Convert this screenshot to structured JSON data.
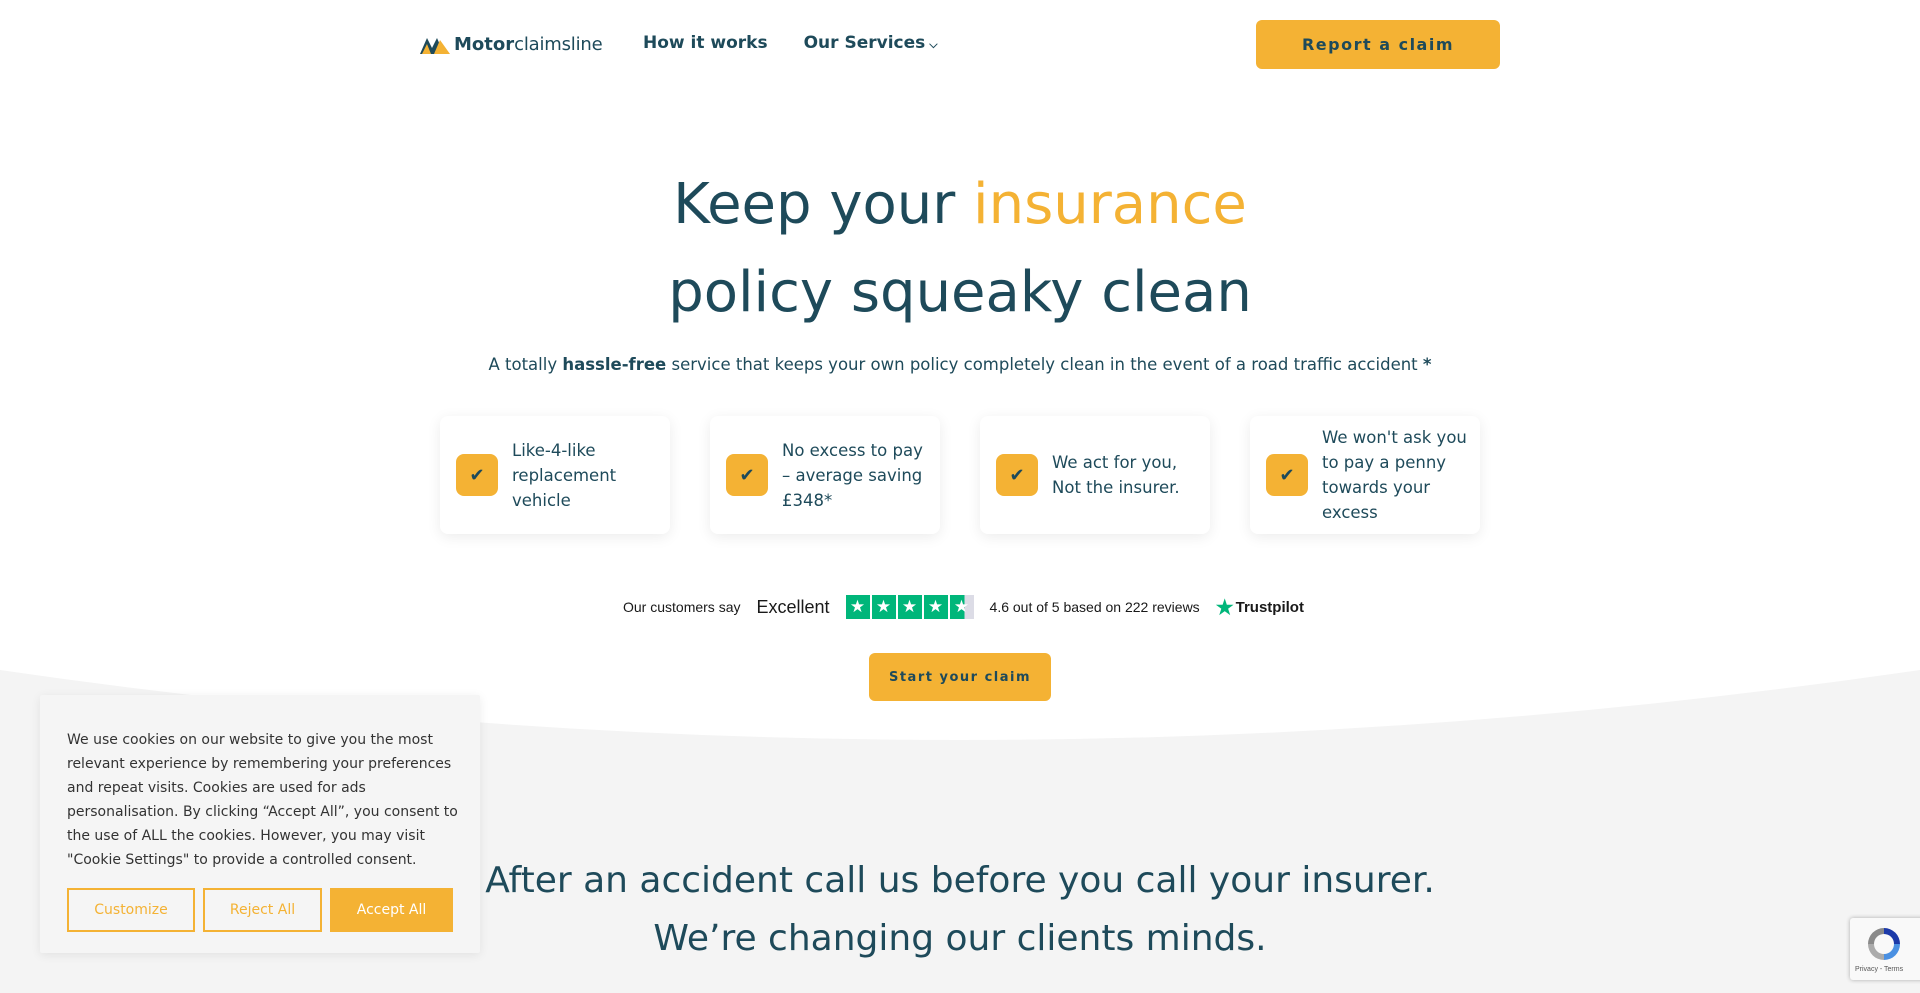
{
  "header": {
    "logo_bold": "Motor",
    "logo_light": "claimsline",
    "nav": [
      {
        "label": "How it works"
      },
      {
        "label": "Our Services"
      }
    ],
    "report_button": "Report a claim"
  },
  "hero": {
    "line1_prefix": "Keep your ",
    "line1_accent": "insurance",
    "line2": "policy squeaky clean",
    "subtitle_pre": "A totally ",
    "subtitle_bold": "hassle-free",
    "subtitle_post": " service that keeps your own policy completely clean in the event of a road traffic accident ",
    "subtitle_star": "*"
  },
  "features": [
    {
      "text": "Like-4-like replacement vehicle"
    },
    {
      "text": "No excess to pay – average saving £348*"
    },
    {
      "text": "We act for you, Not the insurer."
    },
    {
      "text": "We won't ask you to pay a penny towards your excess"
    }
  ],
  "trustpilot": {
    "customers_say": "Our customers say",
    "rating_word": "Excellent",
    "score_text": "4.6 out of 5 based on 222 reviews",
    "brand": "Trustpilot",
    "rating": 4.6
  },
  "start_button": "Start your claim",
  "section": {
    "line1": "After an accident call us before you call your insurer.",
    "line2": "We’re changing our clients minds."
  },
  "cookie": {
    "text": "We use cookies on our website to give you the most relevant experience by remembering your preferences and repeat visits. Cookies are used for ads personalisation. By clicking “Accept All”, you consent to the use of ALL the cookies. However, you may visit \"Cookie Settings\" to provide a controlled consent.",
    "customize": "Customize",
    "reject": "Reject All",
    "accept": "Accept All"
  },
  "recaptcha": {
    "links": "Privacy - Terms"
  },
  "colors": {
    "brand_dark": "#1e4a5a",
    "accent": "#f4b234",
    "trustpilot_green": "#00b67a",
    "section_bg": "#f4f4f4"
  }
}
